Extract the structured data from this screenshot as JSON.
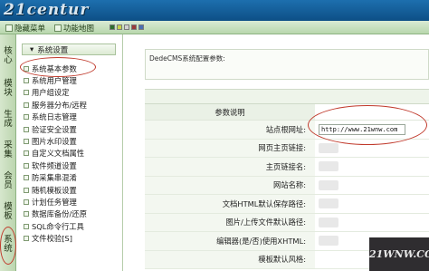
{
  "header": {
    "logo_text": "21centur"
  },
  "toolbar": {
    "items": [
      {
        "label": "隐藏菜单",
        "icon": "hide-menu-icon"
      },
      {
        "label": "功能地图",
        "icon": "function-map-icon"
      }
    ],
    "swatches": [
      "#2e6e2e",
      "#c8d24a",
      "#d2d2d2",
      "#9a3a3a",
      "#4a6fb3"
    ]
  },
  "left_tabs": [
    {
      "label": "核心"
    },
    {
      "label": "模块"
    },
    {
      "label": "生成"
    },
    {
      "label": "采集"
    },
    {
      "label": "会员"
    },
    {
      "label": "模板"
    },
    {
      "label": "系统"
    }
  ],
  "nav": {
    "header": "系统设置",
    "items": [
      "系统基本参数",
      "系统用户管理",
      "用户组设定",
      "服务器分布/远程",
      "系统日志管理",
      "验证安全设置",
      "图片水印设置",
      "自定义文档属性",
      "软件频道设置",
      "防采集串混淆",
      "随机模板设置",
      "计划任务管理",
      "数据库备份/还原",
      "SQL命令行工具",
      "文件校验[S]"
    ]
  },
  "main": {
    "info_text": "DedeCMS系统配置参数:",
    "column_header": "参数说明",
    "rows": [
      {
        "label": "站点根网址:",
        "value": "http://www.21wnw.com"
      },
      {
        "label": "网页主页链接:",
        "value": ""
      },
      {
        "label": "主页链接名:",
        "value": ""
      },
      {
        "label": "网站名称:",
        "value": ""
      },
      {
        "label": "文档HTML默认保存路径:",
        "value": ""
      },
      {
        "label": "图片/上传文件默认路径:",
        "value": ""
      },
      {
        "label": "编辑器(是/否)使用XHTML:",
        "value": ""
      },
      {
        "label": "模板默认风格:",
        "value": ""
      }
    ]
  },
  "watermark": {
    "text": "21WNW.COM"
  },
  "colors": {
    "topbar": "#0d4f86",
    "toolbar": "#b8d7ad",
    "annotation": "#c0392b"
  }
}
